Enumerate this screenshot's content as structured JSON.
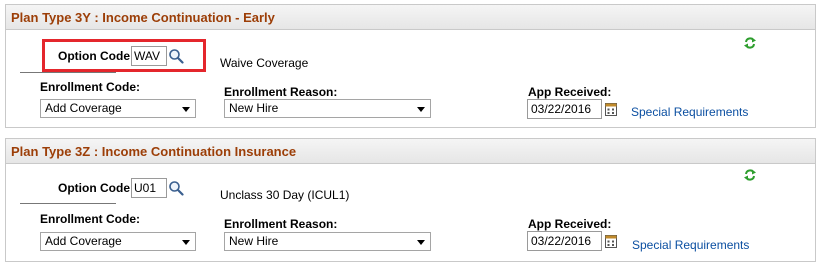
{
  "plans": [
    {
      "title": "Plan Type 3Y : Income Continuation - Early",
      "option_code_label": "Option Code",
      "option_code_value": "WAV",
      "option_description": "Waive Coverage",
      "enrollment_code_label": "Enrollment Code:",
      "enrollment_code_value": "Add Coverage",
      "enrollment_reason_label": "Enrollment Reason:",
      "enrollment_reason_value": "New Hire",
      "app_received_label": "App Received:",
      "app_received_value": "03/22/2016",
      "special_requirements_link": "Special Requirements"
    },
    {
      "title": "Plan Type 3Z : Income Continuation Insurance",
      "option_code_label": "Option Code",
      "option_code_value": "U01",
      "option_description": "Unclass 30 Day (ICUL1)",
      "enrollment_code_label": "Enrollment Code:",
      "enrollment_code_value": "Add Coverage",
      "enrollment_reason_label": "Enrollment Reason:",
      "enrollment_reason_value": "New Hire",
      "app_received_label": "App Received:",
      "app_received_value": "03/22/2016",
      "special_requirements_link": "Special Requirements"
    }
  ],
  "icons": {
    "lookup": "magnifier-icon",
    "calendar": "calendar-icon",
    "refresh": "refresh-icon"
  },
  "colors": {
    "header_text": "#9c3e07",
    "link": "#0b4fa1",
    "highlight_border": "#e4262c",
    "refresh_icon": "#2e9e2e"
  }
}
